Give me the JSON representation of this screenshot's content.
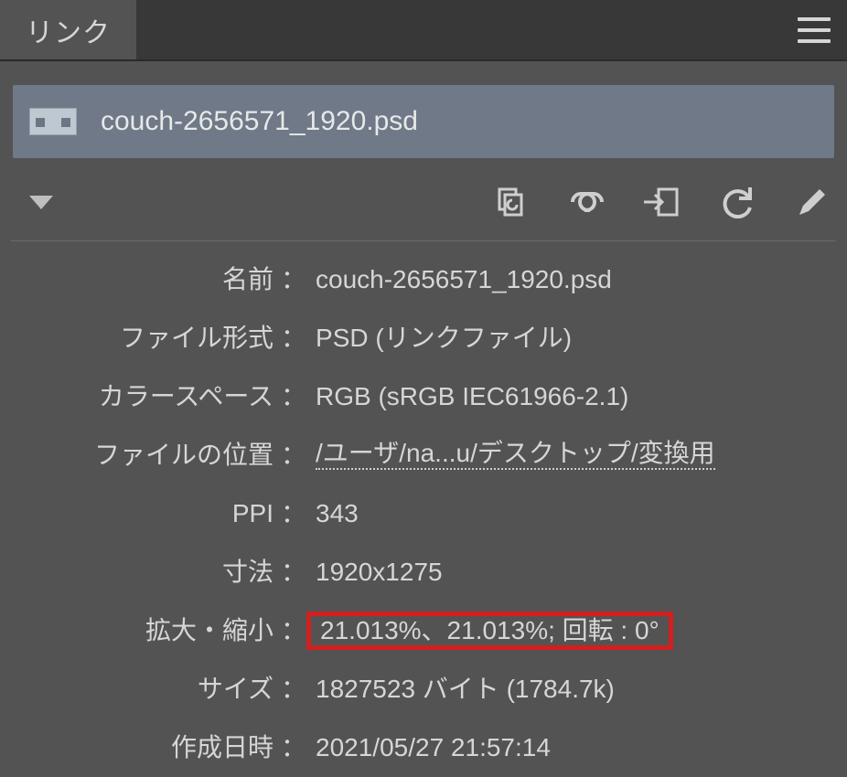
{
  "panel": {
    "tab_label": "リンク"
  },
  "list": {
    "filename": "couch-2656571_1920.psd"
  },
  "info": {
    "name_label": "名前",
    "name_value": "couch-2656571_1920.psd",
    "format_label": "ファイル形式",
    "format_value": "PSD (リンクファイル)",
    "colorspace_label": "カラースペース",
    "colorspace_value": "RGB (sRGB IEC61966-2.1)",
    "location_label": "ファイルの位置",
    "location_value": "/ユーザ/na...u/デスクトップ/変換用",
    "ppi_label": "PPI",
    "ppi_value": "343",
    "dimensions_label": "寸法",
    "dimensions_value": "1920x1275",
    "scale_label": "拡大・縮小",
    "scale_value": "21.013%、21.013%; 回転 : 0°",
    "size_label": "サイズ",
    "size_value": "1827523 バイト (1784.7k)",
    "created_label": "作成日時",
    "created_value": "2021/05/27 21:57:14"
  }
}
